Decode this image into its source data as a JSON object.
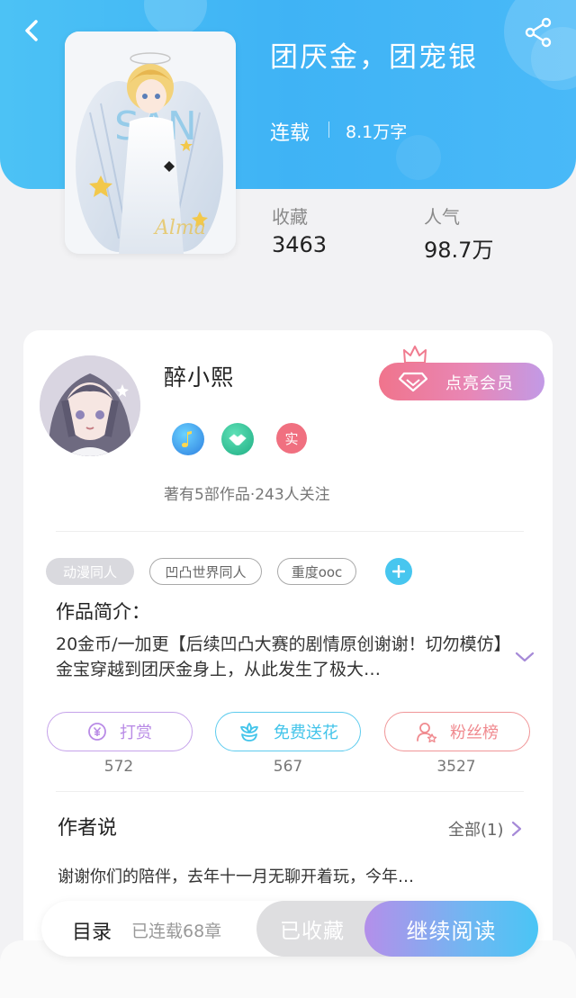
{
  "book": {
    "title": "团厌金，团宠银",
    "status": "连载",
    "word_count": "8.1万字"
  },
  "stats": {
    "favorites_label": "收藏",
    "favorites_value": "3463",
    "popularity_label": "人气",
    "popularity_value": "98.7万"
  },
  "author": {
    "name": "醉小熙",
    "meta": "著有5部作品·243人关注",
    "badges": [
      "music-badge-icon",
      "handshake-badge-icon",
      "实"
    ],
    "vip_button": "点亮会员"
  },
  "tags": [
    "动漫同人",
    "凹凸世界同人",
    "重度ooc"
  ],
  "intro": {
    "title": "作品简介：",
    "text": "20金币/一加更【后续凹凸大赛的剧情原创谢谢！切勿模仿】金宝穿越到团厌金身上，从此发生了极大…"
  },
  "actions": [
    {
      "label": "打赏",
      "count": "572",
      "icon": "coin-icon",
      "color": "#b98be6"
    },
    {
      "label": "免费送花",
      "count": "567",
      "icon": "flower-icon",
      "color": "#42c4ea"
    },
    {
      "label": "粉丝榜",
      "count": "3527",
      "icon": "fan-ranking-icon",
      "color": "#f08a8f"
    }
  ],
  "author_says": {
    "title": "作者说",
    "all_link": "全部(1)",
    "preview": "谢谢你们的陪伴，去年十一月无聊开着玩，今年…"
  },
  "bottom_bar": {
    "toc_label": "目录",
    "chapters": "已连载68章",
    "collected_label": "已收藏",
    "read_label": "继续阅读"
  },
  "colors": {
    "header": "#43b8f5",
    "vip_gradient_start": "#f0748c",
    "vip_gradient_end": "#c29ae6",
    "tag_add": "#47c6ef"
  }
}
